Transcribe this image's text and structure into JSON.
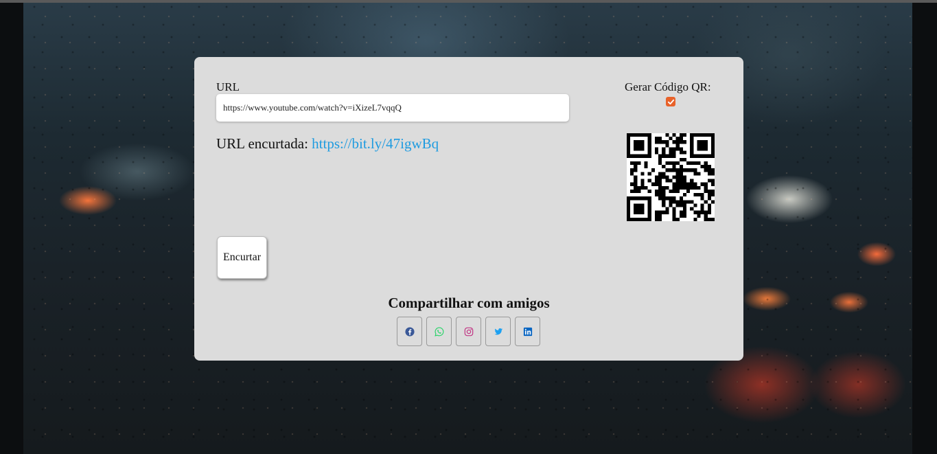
{
  "form": {
    "url_label": "URL",
    "url_value": "https://www.youtube.com/watch?v=iXizeL7vqqQ",
    "short_prefix": "URL encurtada: ",
    "short_url": "https://bit.ly/47igwBq",
    "qr_label": "Gerar Código QR:",
    "qr_checked": true,
    "submit_label": "Encurtar"
  },
  "share": {
    "title": "Compartilhar com amigos",
    "buttons": [
      {
        "icon": "facebook-icon",
        "color": "#3b5998"
      },
      {
        "icon": "whatsapp-icon",
        "color": "#25d366"
      },
      {
        "icon": "instagram-icon",
        "color": "#c13584"
      },
      {
        "icon": "twitter-icon",
        "color": "#1da1f2"
      },
      {
        "icon": "linkedin-icon",
        "color": "#0a66c2"
      }
    ]
  },
  "colors": {
    "accent_checkbox": "#e8622a",
    "link": "#1e9be0",
    "card_bg": "#dcdcdc"
  }
}
